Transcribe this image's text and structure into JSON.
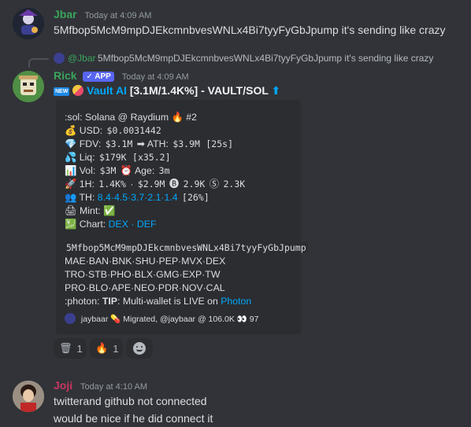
{
  "msg1": {
    "author": "Jbar",
    "timestamp": "Today at 4:09 AM",
    "text": "5Mfbop5McM9mpDJEkcmnbvesWNLx4Bi7tyyFyGbJpump it's sending like crazy",
    "author_color": "#3ba55c"
  },
  "reply": {
    "author": "@Jbar",
    "text": "5Mfbop5McM9mpDJEkcmnbvesWNLx4Bi7tyyFyGbJpump it's sending like crazy"
  },
  "msg2": {
    "author": "Rick",
    "badge": "✓ APP",
    "timestamp": "Today at 4:09 AM",
    "title_prefix": "Vault AI",
    "title_stats": "[3.1M/1.4K%] - VAULT/SOL",
    "title_arrow": "⬆",
    "author_color": "#3ba55c"
  },
  "embed": {
    "chain": ":sol: Solana @ Raydium",
    "rank": "#2",
    "usd_label": "USD:",
    "usd_value": "$0.0031442",
    "fdv_label": "FDV:",
    "fdv_value": "$3.1M",
    "ath_label": "➡ ATH:",
    "ath_value": "$3.9M",
    "ath_age": "[25s]",
    "liq_label": "Liq:",
    "liq_value": "$179K",
    "liq_mult": "[x35.2]",
    "vol_label": "Vol:",
    "vol_value": "$3M",
    "age_label": "Age:",
    "age_value": "3m",
    "h1_label": "1H:",
    "h1_pct": "1.4K%",
    "h1_vol": "$2.9M",
    "h1_b": "2.9K",
    "h1_s": "2.3K",
    "th_label": "TH:",
    "th_values": "8.4·4.5·3.7·2.1·1.4",
    "th_total": "[26%]",
    "mint_label": "Mint:",
    "mint_icon": "✅",
    "chart_label": "Chart:",
    "chart_links": "DEX · DEF",
    "address": "5Mfbop5McM9mpDJEkcmnbvesWNLx4Bi7tyyFyGbJpump",
    "links_row1": "MAE·BAN·BNK·SHU·PEP·MVX·DEX",
    "links_row2": "TRO·STB·PHO·BLX·GMG·EXP·TW",
    "links_row3": "PRO·BLO·APE·NEO·PDR·NOV·CAL",
    "tip_prefix": ":photon:",
    "tip_label": "TIP",
    "tip_text": ": Multi-wallet is LIVE on",
    "tip_link": "Photon",
    "footer": "jaybaar 💊 Migrated, @jaybaar @ 106.0K 👀 97"
  },
  "reactions": [
    {
      "icon": "🗑",
      "count": "1"
    },
    {
      "icon": "🔥",
      "count": "1"
    }
  ],
  "msg3": {
    "author": "Joji",
    "timestamp": "Today at 4:10 AM",
    "line1": "twitterand github not connected",
    "line2": "would be nice if he did connect it",
    "author_color": "#c9365f"
  }
}
